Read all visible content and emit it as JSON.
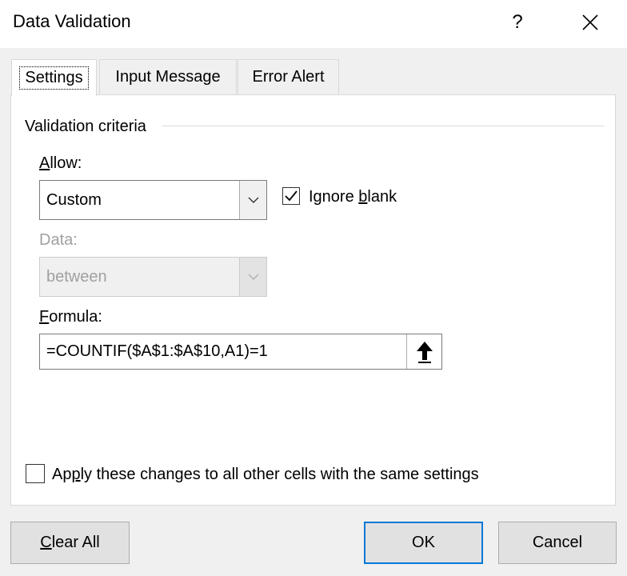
{
  "window": {
    "title": "Data Validation",
    "help_label": "?",
    "close_icon": "close-icon"
  },
  "tabs": [
    {
      "label": "Settings",
      "active": true
    },
    {
      "label": "Input Message",
      "active": false
    },
    {
      "label": "Error Alert",
      "active": false
    }
  ],
  "criteria": {
    "group_label": "Validation criteria",
    "allow_label_key": "A",
    "allow_label_rest": "llow:",
    "allow_value": "Custom",
    "ignore_blank_pre": "Ignore ",
    "ignore_blank_key": "b",
    "ignore_blank_post": "lank",
    "ignore_blank_checked": true,
    "data_label": "Data:",
    "data_value": "between",
    "formula_label_key": "F",
    "formula_label_rest": "ormula:",
    "formula_value": "=COUNTIF($A$1:$A$10,A1)=1"
  },
  "apply_all": {
    "pre": "Ap",
    "key": "p",
    "post": "ly these changes to all other cells with the same settings",
    "checked": false
  },
  "buttons": {
    "clear_key": "C",
    "clear_rest": "lear All",
    "ok": "OK",
    "cancel": "Cancel"
  },
  "colors": {
    "accent": "#0078d7",
    "dialog_bg": "#f0f0f0",
    "disabled_text": "#a0a0a0"
  }
}
